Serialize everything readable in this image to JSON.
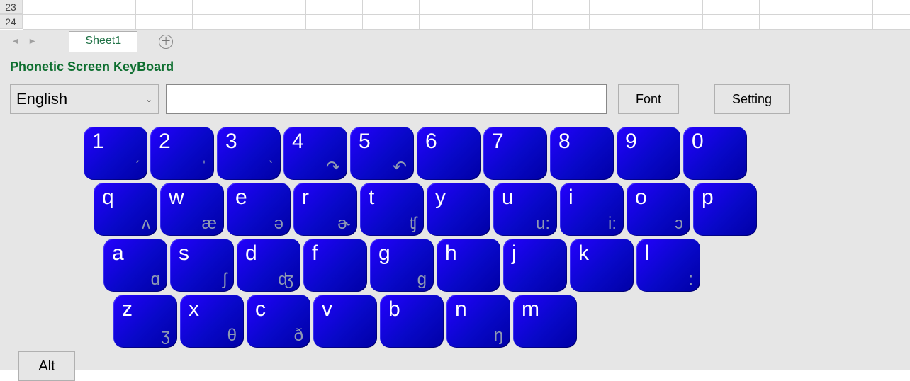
{
  "grid": {
    "row23": "23",
    "row24": "24"
  },
  "tabs": {
    "sheet": "Sheet1"
  },
  "panel": {
    "title": "Phonetic Screen KeyBoard",
    "language": "English",
    "input_value": "",
    "font_label": "Font",
    "setting_label": "Setting",
    "alt_label": "Alt"
  },
  "keyboard": {
    "row1": [
      {
        "main": "1",
        "sub": "ˊ"
      },
      {
        "main": "2",
        "sub": "ˈ"
      },
      {
        "main": "3",
        "sub": "ˋ"
      },
      {
        "main": "4",
        "sub": "↷"
      },
      {
        "main": "5",
        "sub": "↶"
      },
      {
        "main": "6",
        "sub": ""
      },
      {
        "main": "7",
        "sub": ""
      },
      {
        "main": "8",
        "sub": ""
      },
      {
        "main": "9",
        "sub": ""
      },
      {
        "main": "0",
        "sub": ""
      }
    ],
    "row2": [
      {
        "main": "q",
        "sub": "ʌ"
      },
      {
        "main": "w",
        "sub": "æ"
      },
      {
        "main": "e",
        "sub": "ə"
      },
      {
        "main": "r",
        "sub": "ɚ"
      },
      {
        "main": "t",
        "sub": "ʧ"
      },
      {
        "main": "y",
        "sub": ""
      },
      {
        "main": "u",
        "sub": "u:"
      },
      {
        "main": "i",
        "sub": "i:"
      },
      {
        "main": "o",
        "sub": "ɔ"
      },
      {
        "main": "p",
        "sub": ""
      }
    ],
    "row3": [
      {
        "main": "a",
        "sub": "ɑ"
      },
      {
        "main": "s",
        "sub": "ʃ"
      },
      {
        "main": "d",
        "sub": "ʤ"
      },
      {
        "main": "f",
        "sub": ""
      },
      {
        "main": "g",
        "sub": "ɡ"
      },
      {
        "main": "h",
        "sub": ""
      },
      {
        "main": "j",
        "sub": ""
      },
      {
        "main": "k",
        "sub": ""
      },
      {
        "main": "l",
        "sub": ":"
      }
    ],
    "row4": [
      {
        "main": "z",
        "sub": "ʒ"
      },
      {
        "main": "x",
        "sub": "θ"
      },
      {
        "main": "c",
        "sub": "ð"
      },
      {
        "main": "v",
        "sub": ""
      },
      {
        "main": "b",
        "sub": ""
      },
      {
        "main": "n",
        "sub": "ŋ"
      },
      {
        "main": "m",
        "sub": ""
      }
    ]
  }
}
